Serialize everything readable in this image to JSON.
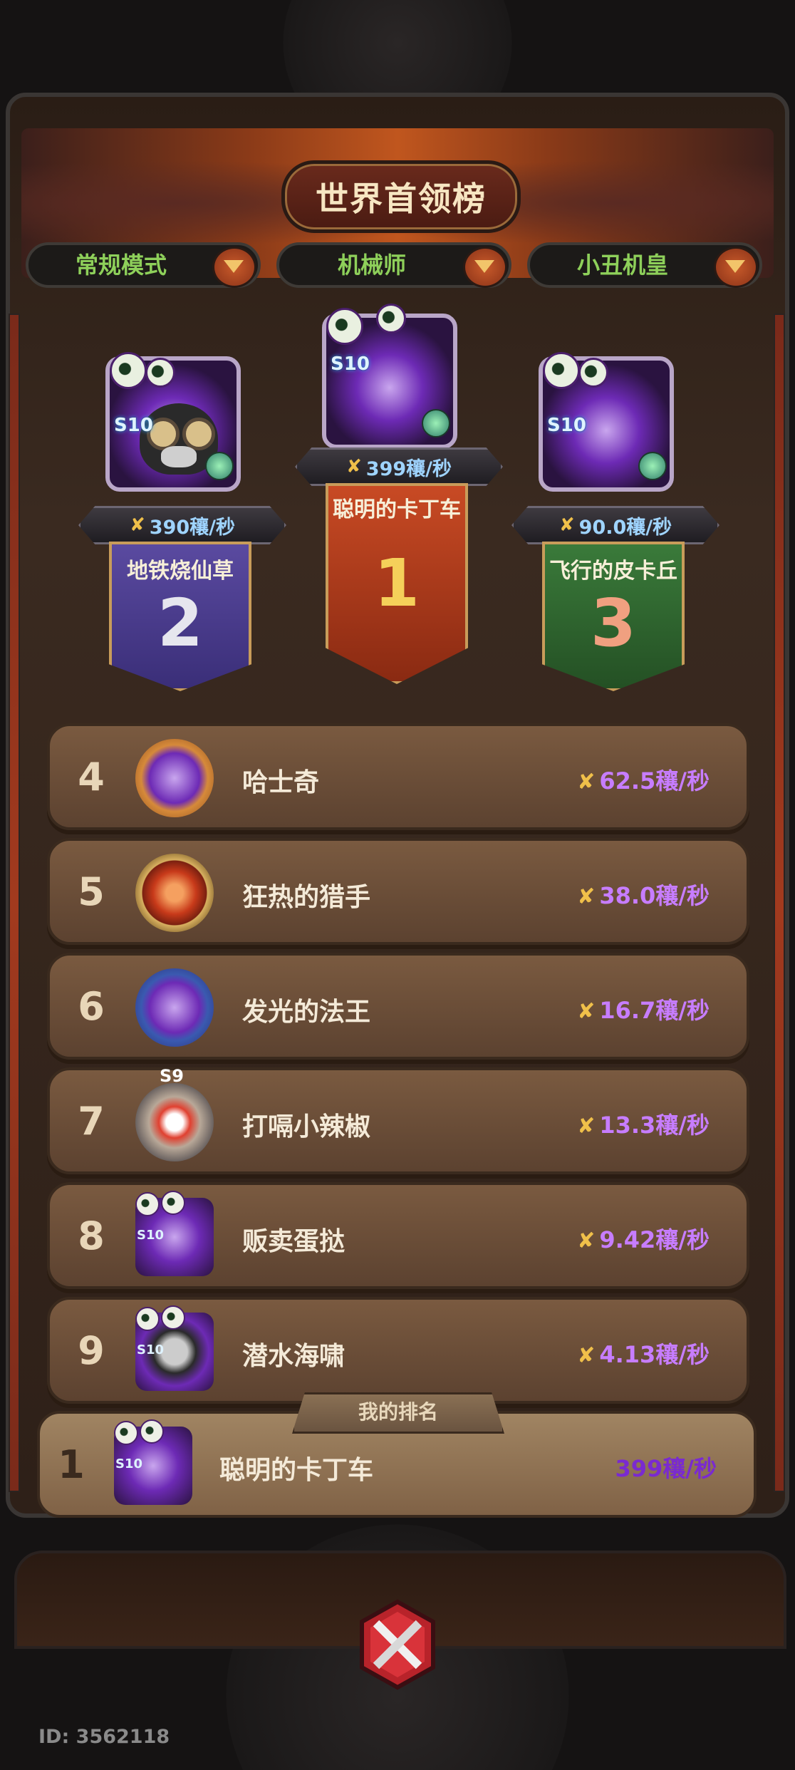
{
  "header": {
    "title": "世界首领榜"
  },
  "tabs": [
    {
      "label": "常规模式"
    },
    {
      "label": "机械师"
    },
    {
      "label": "小丑机皇"
    }
  ],
  "podium": [
    {
      "place": "2",
      "name": "地铁烧仙草",
      "score": "390穰/秒",
      "season": "S10"
    },
    {
      "place": "1",
      "name": "聪明的卡丁车",
      "score": "399穰/秒",
      "season": "S10"
    },
    {
      "place": "3",
      "name": "飞行的皮卡丘",
      "score": "90.0穰/秒",
      "season": "S10"
    }
  ],
  "rows": [
    {
      "rank": "4",
      "name": "哈士奇",
      "score": "62.5穰/秒"
    },
    {
      "rank": "5",
      "name": "狂热的猎手",
      "score": "38.0穰/秒"
    },
    {
      "rank": "6",
      "name": "发光的法王",
      "score": "16.7穰/秒"
    },
    {
      "rank": "7",
      "name": "打嗝小辣椒",
      "score": "13.3穰/秒",
      "season": "S9"
    },
    {
      "rank": "8",
      "name": "贩卖蛋挞",
      "score": "9.42穰/秒",
      "season": "S10"
    },
    {
      "rank": "9",
      "name": "潜水海啸",
      "score": "4.13穰/秒",
      "season": "S10"
    }
  ],
  "my_rank": {
    "label": "我的排名",
    "rank": "1",
    "name": "聪明的卡丁车",
    "score": "399穰/秒",
    "season": "S10"
  },
  "footer": {
    "id": "ID: 3562118"
  },
  "icons": {
    "sword": "✘",
    "close": "close-icon"
  }
}
